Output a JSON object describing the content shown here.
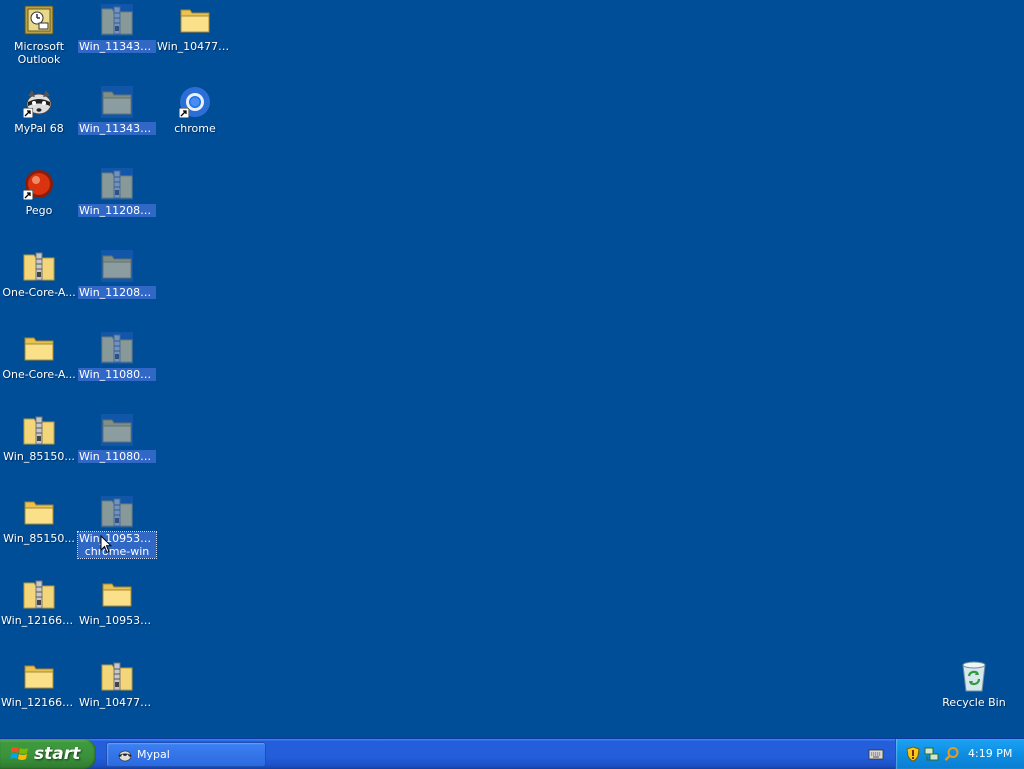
{
  "desktop": {
    "icons": {
      "outlook": "Microsoft Outlook",
      "mypal": "MyPal 68",
      "pego": "Pego",
      "one_core_a_zip": "One-Core-A...",
      "one_core_a_folder": "One-Core-A...",
      "win_85150_zip": "Win_85150...",
      "win_85150_folder": "Win_85150...",
      "win_121661_zip": "Win_121661...",
      "win_121661_folder": "Win_121661...",
      "win_113434_zip": "Win_113434...",
      "win_113434_folder": "Win_113434...",
      "win_112089_zip": "Win_112089...",
      "win_112089_folder": "Win_112089...",
      "win_110804_zip": "Win_110804...",
      "win_110804_folder": "Win_110804...",
      "win_1095399_zip": "Win_1095399_ chrome-win",
      "win_109539_folder": "Win_109539...",
      "win_104773_zip": "Win_104773...",
      "win_104773_folder": "Win_104773...",
      "chrome": "chrome",
      "recycle_bin": "Recycle Bin"
    }
  },
  "taskbar": {
    "start_label": "start",
    "tasks": [
      {
        "label": "Mypal",
        "icon": "mypal-raccoon-icon"
      }
    ],
    "tray_icons": [
      "security-shield-icon",
      "network-icon",
      "search-icon"
    ],
    "clock": "4:19 PM"
  },
  "colors": {
    "desktop_bg": "#004e98",
    "selection": "#3168c6",
    "taskbar": "#245edb",
    "start_button": "#3f9a3f",
    "tray": "#0d8ee3"
  }
}
